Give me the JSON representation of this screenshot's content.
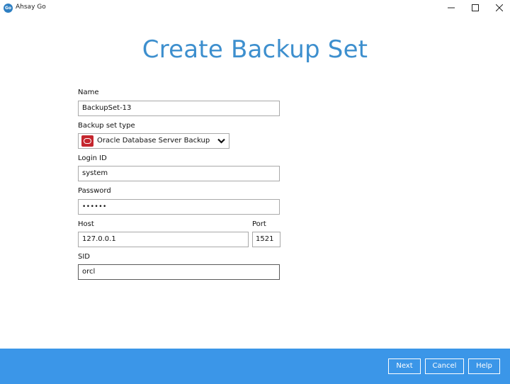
{
  "window": {
    "app_icon_text": "Go",
    "title": "Ahsay Go"
  },
  "page": {
    "title": "Create Backup Set"
  },
  "form": {
    "name_label": "Name",
    "name_value": "BackupSet-13",
    "type_label": "Backup set type",
    "type_value": "Oracle Database Server Backup",
    "login_label": "Login ID",
    "login_value": "system",
    "password_label": "Password",
    "password_value": "••••••",
    "host_label": "Host",
    "host_value": "127.0.0.1",
    "port_label": "Port",
    "port_value": "1521",
    "sid_label": "SID",
    "sid_value": "orcl"
  },
  "footer": {
    "next_label": "Next",
    "cancel_label": "Cancel",
    "help_label": "Help"
  },
  "colors": {
    "accent": "#3b96e8",
    "title": "#3d8fce",
    "oracle": "#c4262e"
  },
  "icons": {
    "app": "ahsay-go-icon",
    "oracle": "oracle-logo-icon",
    "dropdown": "chevron-down-icon",
    "minimize": "minimize-icon",
    "maximize": "maximize-icon",
    "close": "close-icon"
  }
}
